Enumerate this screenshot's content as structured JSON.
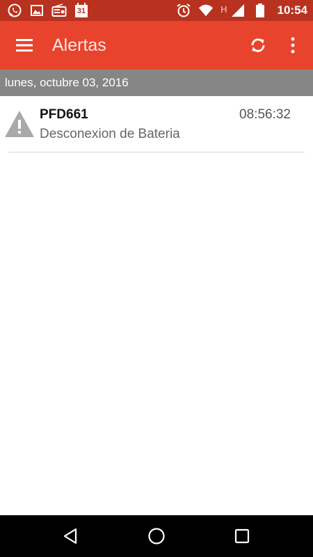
{
  "status_bar": {
    "calendar_day": "31",
    "network_indicator": "H",
    "time": "10:54",
    "icons": [
      "whatsapp-icon",
      "image-icon",
      "radio-icon",
      "calendar-icon",
      "alarm-icon",
      "wifi-icon",
      "signal-icon",
      "battery-icon"
    ]
  },
  "app_bar": {
    "title": "Alertas",
    "icons": [
      "menu-icon",
      "sync-icon",
      "more-vert-icon"
    ]
  },
  "date_header": {
    "label": "lunes, octubre 03, 2016"
  },
  "alerts": [
    {
      "plate": "PFD661",
      "time": "08:56:32",
      "description": "Desconexion de Bateria",
      "icon": "warning-icon"
    }
  ],
  "nav_bar": {
    "icons": [
      "back-icon",
      "home-icon",
      "recents-icon"
    ]
  },
  "colors": {
    "status_bar": "#b8321f",
    "app_bar": "#e8442d",
    "date_header": "#868686",
    "nav_bar": "#000000"
  }
}
